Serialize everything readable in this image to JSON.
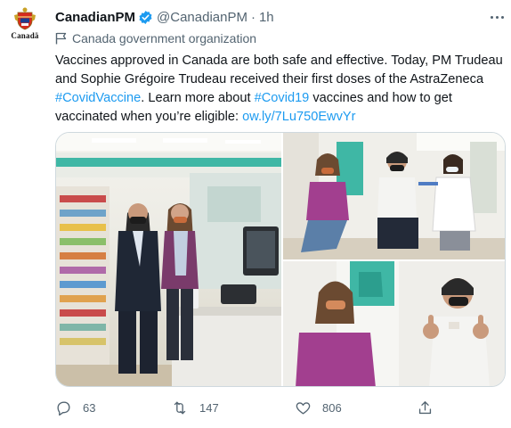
{
  "author": {
    "name": "CanadianPM",
    "handle": "@CanadianPM",
    "separator": "·",
    "time": "1h",
    "verified": true,
    "avatar_wordmark": "Canadä",
    "label": "Canada government organization",
    "avatar_icon": "canada-coat-of-arms-icon"
  },
  "tweet": {
    "line1": "Vaccines approved in Canada are both safe and effective. Today, PM Trudeau",
    "line2": "and Sophie Grégoire Trudeau received their first doses of the AstraZeneca",
    "line3_hashtag1": "#CovidVaccine",
    "line3_mid": ". Learn more about ",
    "line3_hashtag2": "#Covid19",
    "line3_end": " vaccines and how to get",
    "line4_text": "vaccinated when you’re eligible: ",
    "line4_link": "ow.ly/7Lu750EwvYr"
  },
  "media": {
    "photos": [
      {
        "subject": "PM Trudeau and Sophie Grégoire Trudeau in pharmacy"
      },
      {
        "subject": "Vaccine being administered"
      },
      {
        "subject": "Sophie Grégoire Trudeau and PM Trudeau thumbs up"
      }
    ]
  },
  "actions": {
    "replies": "63",
    "retweets": "147",
    "likes": "806"
  },
  "colors": {
    "link": "#1d9bf0",
    "secondary_text": "#536471",
    "verified": "#1d9bf0",
    "border": "#cfd9de"
  }
}
